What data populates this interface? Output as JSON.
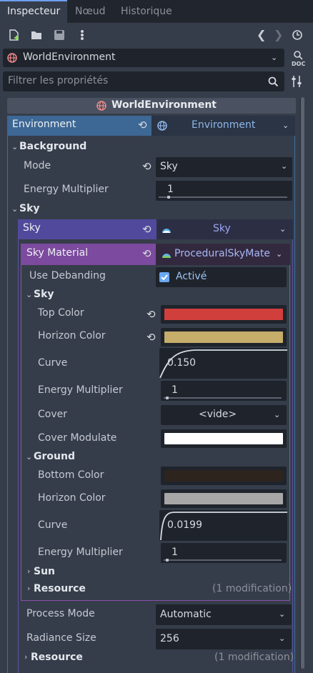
{
  "tabs": [
    {
      "label": "Inspecteur"
    },
    {
      "label": "Nœud"
    },
    {
      "label": "Historique"
    }
  ],
  "object_selector": {
    "value": "WorldEnvironment"
  },
  "filter": {
    "placeholder": "Filtrer les propriétés"
  },
  "header": {
    "title": "WorldEnvironment"
  },
  "environment": {
    "label": "Environment",
    "resource": "Environment"
  },
  "background": {
    "category": "Background",
    "mode_label": "Mode",
    "mode_value": "Sky",
    "energy_label": "Energy Multiplier",
    "energy_value": "1"
  },
  "sky_section": {
    "category": "Sky",
    "sky_label": "Sky",
    "sky_resource": "Sky"
  },
  "sky_material": {
    "label": "Sky Material",
    "resource": "ProceduralSkyMate",
    "use_debanding_label": "Use Debanding",
    "use_debanding_value": "Activé"
  },
  "sky_sub": {
    "category": "Sky",
    "top_color_label": "Top Color",
    "top_color": "#d13f3d",
    "horizon_color_label": "Horizon Color",
    "horizon_color": "#c6ad6a",
    "curve_label": "Curve",
    "curve_value": "0.150",
    "energy_label": "Energy Multiplier",
    "energy_value": "1",
    "cover_label": "Cover",
    "cover_value": "<vide>",
    "cover_modulate_label": "Cover Modulate",
    "cover_modulate_color": "#ffffff"
  },
  "ground": {
    "category": "Ground",
    "bottom_color_label": "Bottom Color",
    "bottom_color": "#2d241e",
    "horizon_color_label": "Horizon Color",
    "horizon_color": "#a7a7a7",
    "curve_label": "Curve",
    "curve_value": "0.0199",
    "energy_label": "Energy Multiplier",
    "energy_value": "1"
  },
  "sun": {
    "category": "Sun"
  },
  "resource_inner": {
    "category": "Resource",
    "note": "(1 modification)"
  },
  "process_mode": {
    "label": "Process Mode",
    "value": "Automatic"
  },
  "radiance_size": {
    "label": "Radiance Size",
    "value": "256"
  },
  "resource_outer": {
    "category": "Resource",
    "note": "(1 modification)"
  }
}
